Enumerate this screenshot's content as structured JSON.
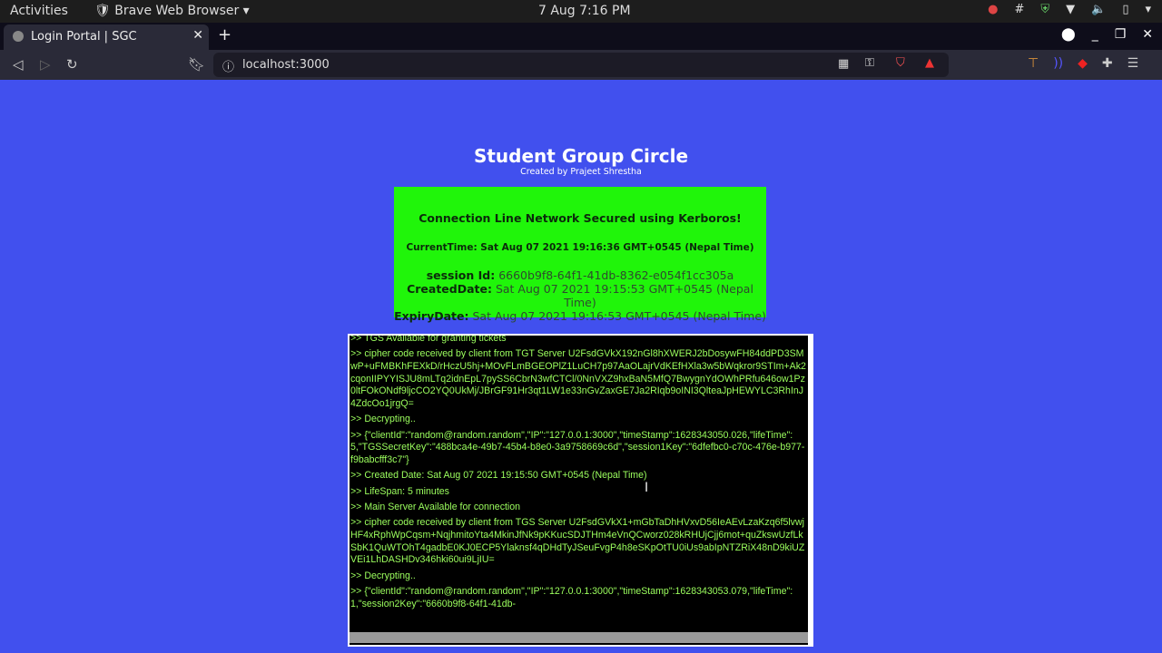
{
  "os": {
    "activities": "Activities",
    "app": "Brave Web Browser",
    "clock": "7 Aug  7:16 PM"
  },
  "browser": {
    "tab_title": "Login Portal | SGC",
    "url": "localhost:3000"
  },
  "page": {
    "title": "Student Group Circle",
    "subtitle": "Created by Prajeet Shrestha",
    "card": {
      "heading": "Connection Line Network Secured using Kerboros!",
      "current_time": "CurrentTime: Sat Aug 07 2021 19:16:36 GMT+0545 (Nepal Time)",
      "session_label": "session Id:",
      "session_value": " 6660b9f8-64f1-41db-8362-e054f1cc305a",
      "created_label": "CreatedDate:",
      "created_value": " Sat Aug 07 2021 19:15:53 GMT+0545 (Nepal Time)",
      "expiry_label": "ExpiryDate:",
      "expiry_value": " Sat Aug 07 2021 19:16:53 GMT+0545 (Nepal Time)"
    },
    "log": [
      ">> TGS Available for granting tickets",
      ">> cipher code received by client from TGT Server U2FsdGVkX192nGl8hXWERJ2bDosywFH84ddPD3SMwP+uFMBKhFEXkD/rHczU5hj+MOvFLmBGEOPlZ1LuCH7p97AaOLajrVdKEfHXla3w5bWqkror9STIm+Ak2cqonIIPYYISJU8mLTq2idnEpL7pySS6CbrN3wfCTCl/0NnVXZ9hxBaN5MfQ7BwygnYdOWhPRfu646ow1Pz0ltFOkONdf9ljcCO2YQ0UkMj/JBrGF91Hr3qt1LW1e33nGvZaxGE7Ja2RIqb9oINI3QlteaJpHEWYLC3RhInJ4ZdcOo1jrgQ=",
      ">> Decrypting..",
      ">> {\"clientId\":\"random@random.random\",\"IP\":\"127.0.0.1:3000\",\"timeStamp\":1628343050.026,\"lifeTime\":5,\"TGSSecretKey\":\"488bca4e-49b7-45b4-b8e0-3a9758669c6d\",\"session1Key\":\"6dfefbc0-c70c-476e-b977-f9babcfff3c7\"}",
      ">> Created Date: Sat Aug 07 2021 19:15:50 GMT+0545 (Nepal Time)",
      ">> LifeSpan: 5 minutes",
      ">> Main Server Available for connection",
      ">> cipher code received by client from TGS Server U2FsdGVkX1+mGbTaDhHVxvD56IeAEvLzaKzq6f5lvwjHF4xRphWpCqsm+NqjhmitoYta4MkinJfNk9pKKucSDJTHm4eVnQCworz028kRHUjCjj6mot+quZkswUzfLkSbK1QuWTOhT4gadbE0KJ0ECP5Ylaknsf4qDHdTyJSeuFvgP4h8eSKpOtTU0iUs9abIpNTZRiX48nD9kiUZVEi1LhDASHDv346hki60ui9LjIU=",
      ">> Decrypting..",
      ">> {\"clientId\":\"random@random.random\",\"IP\":\"127.0.0.1:3000\",\"timeStamp\":1628343053.079,\"lifeTime\":1,\"session2Key\":\"6660b9f8-64f1-41db-"
    ]
  }
}
